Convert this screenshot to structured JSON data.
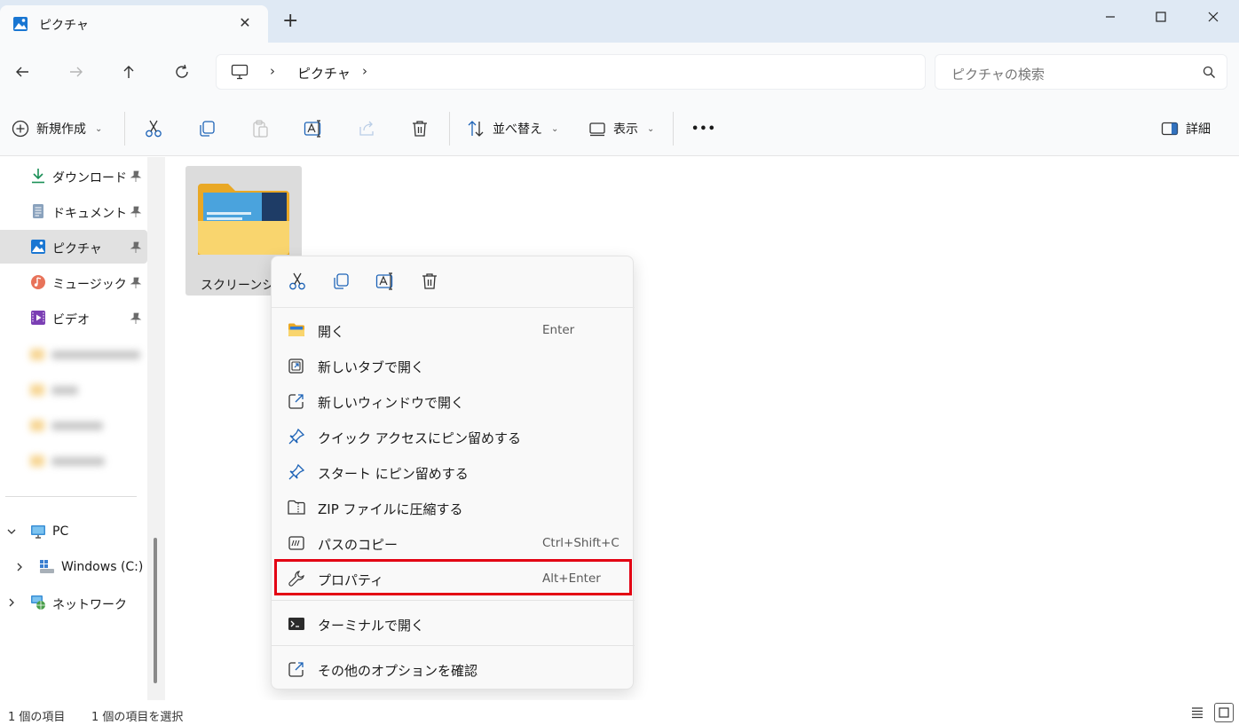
{
  "tab": {
    "title": "ピクチャ",
    "close": "✕"
  },
  "window": {
    "new_tab": "+"
  },
  "address": {
    "crumb": "ピクチャ",
    "sep": "›"
  },
  "search": {
    "placeholder": "ピクチャの検索"
  },
  "commands": {
    "new_label": "新規作成",
    "sort_label": "並べ替え",
    "view_label": "表示",
    "more_label": "•••",
    "details_label": "詳細",
    "chevron": "⌄"
  },
  "sidebar": {
    "quick": [
      {
        "label": "ダウンロード",
        "icon": "download-icon"
      },
      {
        "label": "ドキュメント",
        "icon": "document-icon"
      },
      {
        "label": "ピクチャ",
        "icon": "pictures-icon",
        "selected": true
      },
      {
        "label": "ミュージック",
        "icon": "music-icon"
      },
      {
        "label": "ビデオ",
        "icon": "video-icon"
      }
    ],
    "pc_label": "PC",
    "drive_label": "Windows (C:)",
    "network_label": "ネットワーク"
  },
  "content": {
    "folder_name": "スクリーンショ"
  },
  "context_menu": {
    "items": [
      {
        "label": "開く",
        "accel": "Enter",
        "icon": "folder-open-icon"
      },
      {
        "label": "新しいタブで開く",
        "accel": "",
        "icon": "new-tab-icon"
      },
      {
        "label": "新しいウィンドウで開く",
        "accel": "",
        "icon": "new-window-icon"
      },
      {
        "label": "クイック アクセスにピン留めする",
        "accel": "",
        "icon": "pin-icon"
      },
      {
        "label": "スタート にピン留めする",
        "accel": "",
        "icon": "pin-start-icon"
      },
      {
        "label": "ZIP ファイルに圧縮する",
        "accel": "",
        "icon": "zip-icon"
      },
      {
        "label": "パスのコピー",
        "accel": "Ctrl+Shift+C",
        "icon": "copy-path-icon"
      },
      {
        "label": "プロパティ",
        "accel": "Alt+Enter",
        "icon": "wrench-icon"
      },
      {
        "label": "ターミナルで開く",
        "accel": "",
        "icon": "terminal-icon"
      },
      {
        "label": "その他のオプションを確認",
        "accel": "",
        "icon": "more-options-icon"
      }
    ]
  },
  "status": {
    "count": "1 個の項目",
    "selected": "1 個の項目を選択"
  },
  "colors": {
    "accent": "#0067c0",
    "highlight": "#e30013",
    "folder": "#f7c948"
  }
}
